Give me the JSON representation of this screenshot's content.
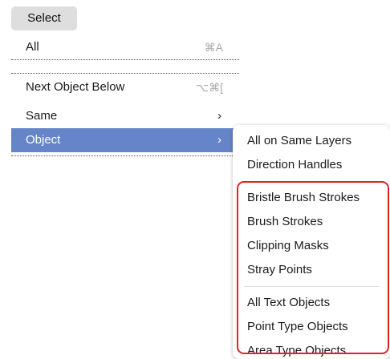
{
  "menubar": {
    "title": "Select"
  },
  "menu": {
    "items": [
      {
        "label": "All",
        "shortcut": "⌘A"
      },
      {
        "label": "Next Object Below",
        "shortcut": "⌥⌘["
      },
      {
        "label": "Same",
        "chevron": "›"
      },
      {
        "label": "Object",
        "chevron": "›"
      }
    ]
  },
  "submenu": {
    "group1": [
      "All on Same Layers",
      "Direction Handles"
    ],
    "group2": [
      "Bristle Brush Strokes",
      "Brush Strokes",
      "Clipping Masks",
      "Stray Points"
    ],
    "group3": [
      "All Text Objects",
      "Point Type Objects",
      "Area Type Objects"
    ]
  },
  "colors": {
    "highlight": "#6585c8",
    "annotation_box": "#e0232b"
  }
}
